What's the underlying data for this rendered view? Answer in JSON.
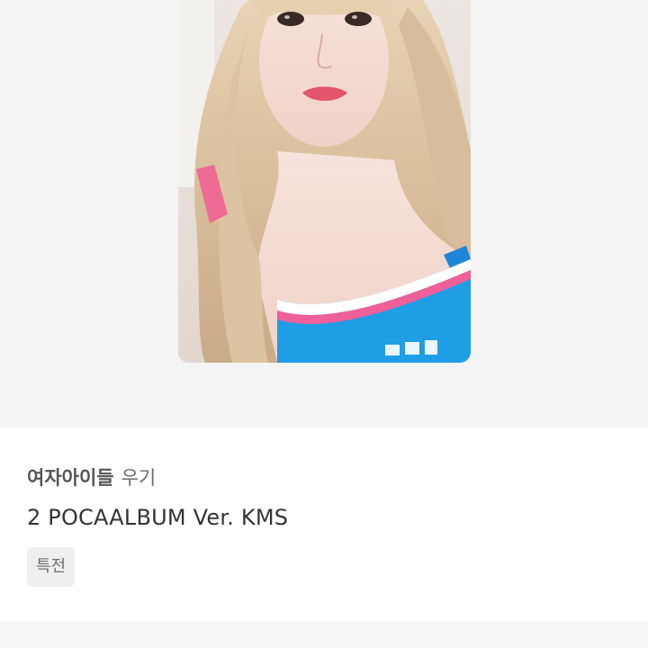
{
  "product": {
    "group": "여자아이들",
    "member": "우기",
    "title": "2 POCAALBUM Ver. KMS",
    "tag": "특전"
  },
  "image": {
    "description_icon": "photocard-image"
  }
}
